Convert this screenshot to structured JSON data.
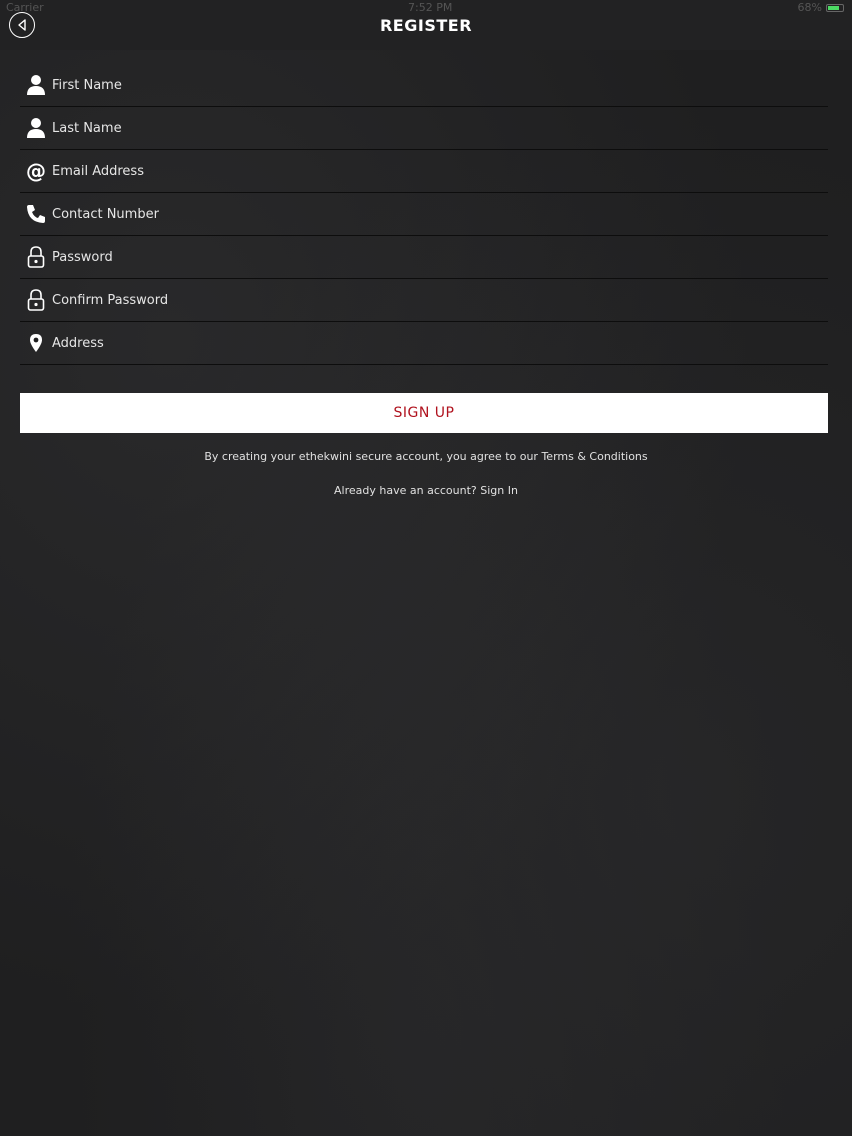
{
  "status": {
    "carrier": "Carrier",
    "time": "7:52 PM",
    "battery": "68%",
    "battery_color": "#4cd964"
  },
  "header": {
    "title": "REGISTER",
    "back_icon": "back-arrow-circle-icon"
  },
  "form": {
    "fields": [
      {
        "placeholder": "First Name",
        "icon": "person-icon",
        "type": "text"
      },
      {
        "placeholder": "Last Name",
        "icon": "person-icon",
        "type": "text"
      },
      {
        "placeholder": "Email Address",
        "icon": "at-sign-icon",
        "type": "email"
      },
      {
        "placeholder": "Contact Number",
        "icon": "phone-icon",
        "type": "tel"
      },
      {
        "placeholder": "Password",
        "icon": "lock-icon",
        "type": "password"
      },
      {
        "placeholder": "Confirm Password",
        "icon": "lock-icon",
        "type": "password"
      },
      {
        "placeholder": "Address",
        "icon": "location-pin-icon",
        "type": "text"
      }
    ]
  },
  "signup": {
    "label": "SIGN UP",
    "label_color": "#b0121e"
  },
  "terms": {
    "prefix": "By creating your ethekwini secure account, you agree to our ",
    "link": "Terms & Conditions"
  },
  "signin": {
    "prefix": "Already have an account? ",
    "link": "Sign In"
  }
}
